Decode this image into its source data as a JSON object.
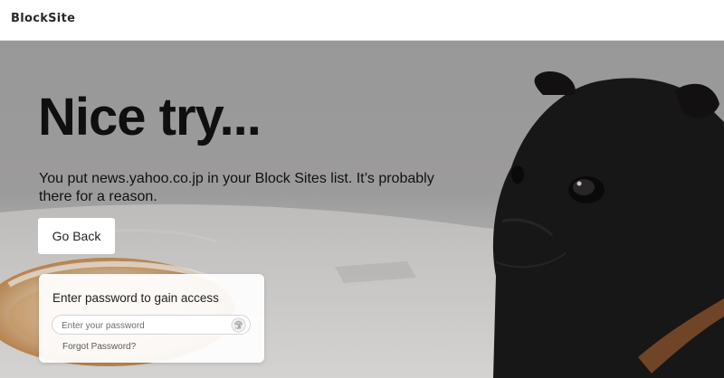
{
  "app": {
    "logo_text": "BlockSite"
  },
  "block_page": {
    "headline": "Nice try...",
    "message": "You put news.yahoo.co.jp in your Block Sites list. It’s probably there for a reason.",
    "go_back_label": "Go Back"
  },
  "password_panel": {
    "title": "Enter password to gain access",
    "input_placeholder": "Enter your password",
    "input_value": "",
    "forgot_link": "Forgot Password?"
  },
  "icons": [
    "fingerprint-icon"
  ],
  "colors": {
    "headline": "#0f0f0f",
    "background": "#aaa9a9",
    "button_bg": "#ffffff"
  }
}
